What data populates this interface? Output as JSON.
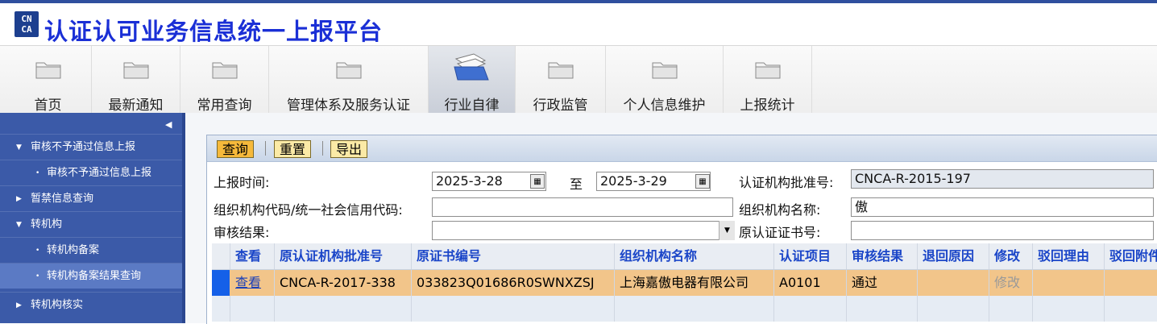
{
  "app": {
    "logo_text": "CN CA",
    "title": "认证认可业务信息统一上报平台"
  },
  "nav": [
    {
      "label": "首页",
      "active": false
    },
    {
      "label": "最新通知",
      "active": false
    },
    {
      "label": "常用查询",
      "active": false
    },
    {
      "label": "管理体系及服务认证",
      "active": false
    },
    {
      "label": "行业自律",
      "active": true
    },
    {
      "label": "行政监管",
      "active": false
    },
    {
      "label": "个人信息维护",
      "active": false
    },
    {
      "label": "上报统计",
      "active": false
    }
  ],
  "sidebar": {
    "collapse_icon": "◀",
    "items": [
      {
        "label": "审核不予通过信息上报",
        "arrow": "▼"
      },
      {
        "label": "审核不予通过信息上报",
        "dot": "•"
      },
      {
        "label": "暂禁信息查询",
        "arrow": "▶"
      },
      {
        "label": "转机构",
        "arrow": "▼"
      },
      {
        "label": "转机构备案",
        "dot": "•"
      },
      {
        "label": "转机构备案结果查询",
        "dot": "•"
      },
      {
        "label": "转机构核实",
        "arrow": "▶"
      }
    ]
  },
  "toolbar": {
    "query": "查询",
    "reset": "重置",
    "export": "导出"
  },
  "form": {
    "report_time_label": "上报时间:",
    "date_from": "2025-3-28",
    "to_label": "至",
    "date_to": "2025-3-29",
    "cert_body_label": "认证机构批准号:",
    "cert_body_value": "CNCA-R-2015-197",
    "org_code_label": "组织机构代码/统一社会信用代码:",
    "org_code_value": "",
    "org_name_label": "组织机构名称:",
    "org_name_value": "傲",
    "result_label": "审核结果:",
    "result_value": "",
    "orig_cert_label": "原认证证书号:",
    "orig_cert_value": ""
  },
  "table": {
    "headers": [
      "查看",
      "原认证机构批准号",
      "原证书编号",
      "组织机构名称",
      "认证项目",
      "审核结果",
      "退回原因",
      "修改",
      "驳回理由",
      "驳回附件"
    ],
    "rows": [
      {
        "view": "查看",
        "orig_body": "CNCA-R-2017-338",
        "cert_no": "033823Q01686R0SWNXZSJ",
        "org": "上海嘉傲电器有限公司",
        "project": "A0101",
        "result": "通过",
        "reason": "",
        "modify": "修改",
        "reject": "",
        "attach": ""
      }
    ]
  },
  "colors": {
    "accent": "#1a2fd6",
    "sidebar": "#3b5aa8",
    "selected_row": "#f2c58a",
    "row_marker": "#1560e8"
  }
}
